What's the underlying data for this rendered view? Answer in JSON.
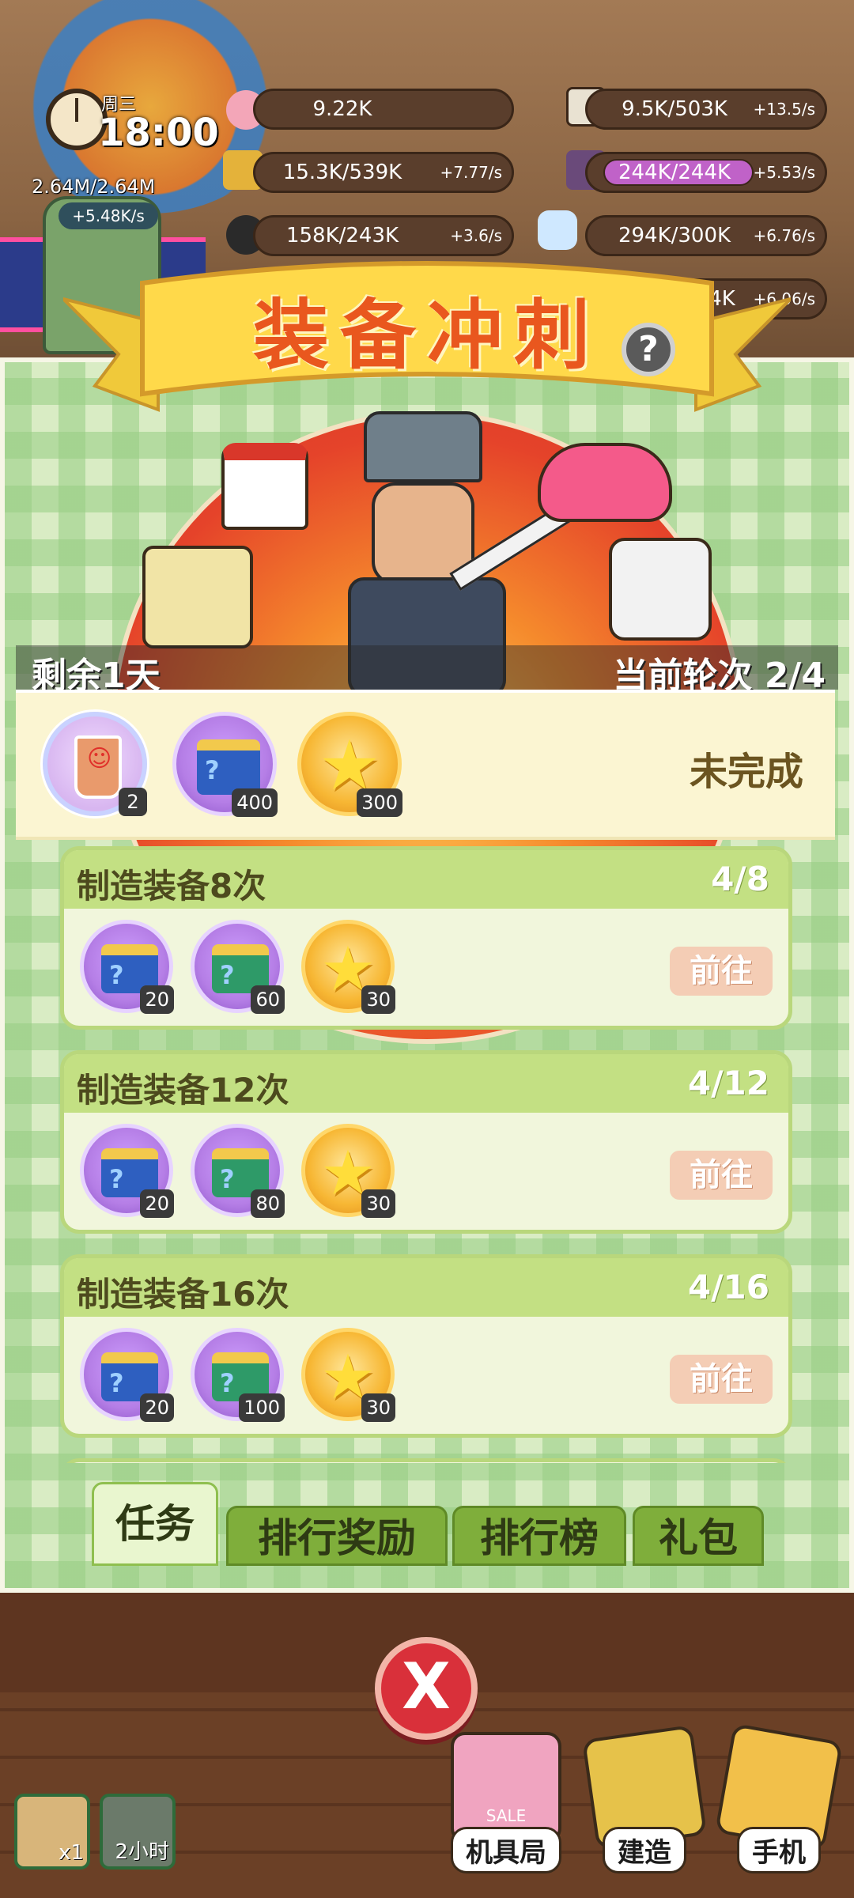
{
  "hud": {
    "weekday": "周三",
    "time": "18:00",
    "cash": "2.64M/2.64M",
    "cash_rate": "+5.48K/s",
    "resources": [
      {
        "icon": "peach-icon",
        "value": "9.22K",
        "rate": ""
      },
      {
        "icon": "knife-icon",
        "value": "9.5K/503K",
        "rate": "+13.5/s"
      },
      {
        "icon": "gold-bar-icon",
        "value": "15.3K/539K",
        "rate": "+7.77/s"
      },
      {
        "icon": "purple-bar-icon",
        "value": "244K/244K",
        "rate": "+5.53/s"
      },
      {
        "icon": "coal-icon",
        "value": "158K/243K",
        "rate": "+3.6/s"
      },
      {
        "icon": "bottle-icon",
        "value": "294K/300K",
        "rate": "+6.76/s"
      },
      {
        "icon": "hidden-icon",
        "value": "4K",
        "rate": "+6.06/s"
      }
    ]
  },
  "event": {
    "title": "装备冲刺",
    "help": "?",
    "days_left": "剩余1天",
    "round": "当前轮次 2/4",
    "status": "未完成",
    "main_rewards": [
      {
        "icon": "bubble-tea-icon",
        "count": "2"
      },
      {
        "icon": "mystery-box-icon",
        "count": "400"
      },
      {
        "icon": "star-icon",
        "count": "300"
      }
    ]
  },
  "tasks": [
    {
      "title": "制造装备8次",
      "progress": "4/8",
      "go": "前往",
      "rewards": [
        {
          "icon": "blue-box-icon",
          "count": "20"
        },
        {
          "icon": "green-box-icon",
          "count": "60"
        },
        {
          "icon": "star-icon",
          "count": "30"
        }
      ]
    },
    {
      "title": "制造装备12次",
      "progress": "4/12",
      "go": "前往",
      "rewards": [
        {
          "icon": "blue-box-icon",
          "count": "20"
        },
        {
          "icon": "green-box-icon",
          "count": "80"
        },
        {
          "icon": "star-icon",
          "count": "30"
        }
      ]
    },
    {
      "title": "制造装备16次",
      "progress": "4/16",
      "go": "前往",
      "rewards": [
        {
          "icon": "blue-box-icon",
          "count": "20"
        },
        {
          "icon": "green-box-icon",
          "count": "100"
        },
        {
          "icon": "star-icon",
          "count": "30"
        }
      ]
    }
  ],
  "tabs": [
    "任务",
    "排行奖励",
    "排行榜",
    "礼包"
  ],
  "active_tab": "任务",
  "close": "X",
  "dock": {
    "slot1": "x1",
    "slot2": "2小时",
    "shop": "机具局",
    "build": "建造",
    "phone": "手机",
    "shop_sign": "SALE"
  },
  "colors": {
    "title_orange": "#e9571e",
    "grid_green": "#d9ecc4",
    "tab_green": "#7fae3b",
    "close_red": "#d9303a"
  }
}
